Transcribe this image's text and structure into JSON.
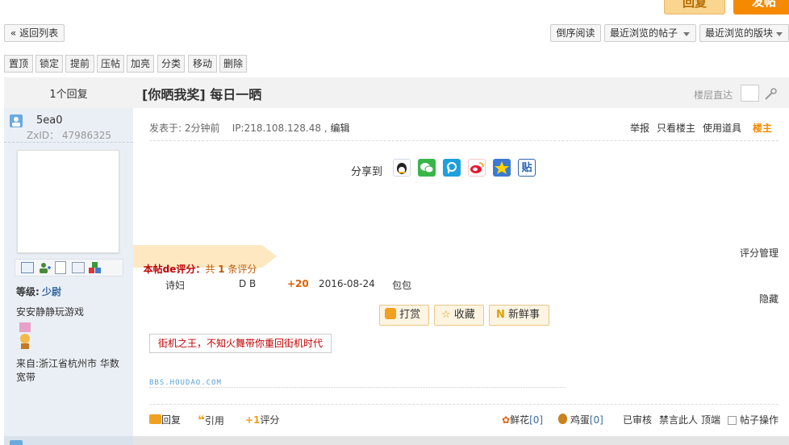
{
  "colors": {
    "accent": "#f58a00",
    "orange_light": "#f9d58f",
    "title": "#333333",
    "red": "#c00000",
    "side_bg": "#e9eff5",
    "level": "#3b6aa0"
  },
  "top_buttons": {
    "reply": "回复",
    "post": "发帖"
  },
  "nav": {
    "back": "« 返回列表",
    "reverse": "倒序阅读",
    "recent_posts": "最近浏览的帖子",
    "recent_boards": "最近浏览的版块"
  },
  "mod_buttons": [
    "置顶",
    "锁定",
    "提前",
    "压帖",
    "加亮",
    "分类",
    "移动",
    "删除"
  ],
  "thread": {
    "reply_count": "1个回复",
    "title": "[你晒我奖] 每日一晒",
    "floor_jump": "楼层直达"
  },
  "user": {
    "name": "5ea0",
    "zxid": "ZxID： 47986325",
    "level_label": "等级:",
    "level": "少尉",
    "signature": "安安静静玩游戏",
    "from": "来自:浙江省杭州市 华数宽带"
  },
  "post": {
    "meta": "发表于: 2分钟前    IP:218.108.128.48 ,",
    "edit": "编辑",
    "report": "举报",
    "only_author": "只看楼主",
    "use_tool": "使用道具",
    "floor": "楼主",
    "share_label": "分享到",
    "share_icons": [
      "qq-icon",
      "wechat-icon",
      "pengyou-icon",
      "weibo-icon",
      "qzone-icon",
      "tieba-icon"
    ],
    "rating_title": "本帖de评分：",
    "rating_summary_prefix": "共 ",
    "rating_count": "1",
    "rating_summary_suffix": " 条评分",
    "rating_manage": "评分管理",
    "hide": "隐藏",
    "rating_row": {
      "user": "诗妇",
      "code": "D B",
      "score": "+20",
      "date": "2016-08-24",
      "note": "包包"
    },
    "actions": {
      "reward": "打赏",
      "favorite": "收藏",
      "news": "新鲜事"
    },
    "ad": "街机之王，不知火舞带你重回街机时代",
    "sig_link": "BBS.HOUDAO.COM"
  },
  "footer": {
    "reply": "回复",
    "quote": "引用",
    "rate": "评分",
    "flower": "鲜花",
    "flower_count": "[0]",
    "egg": "鸡蛋",
    "egg_count": "[0]",
    "reviewed": "已审核",
    "ban": "禁言此人",
    "top": "顶端",
    "post_ops": "帖子操作"
  }
}
